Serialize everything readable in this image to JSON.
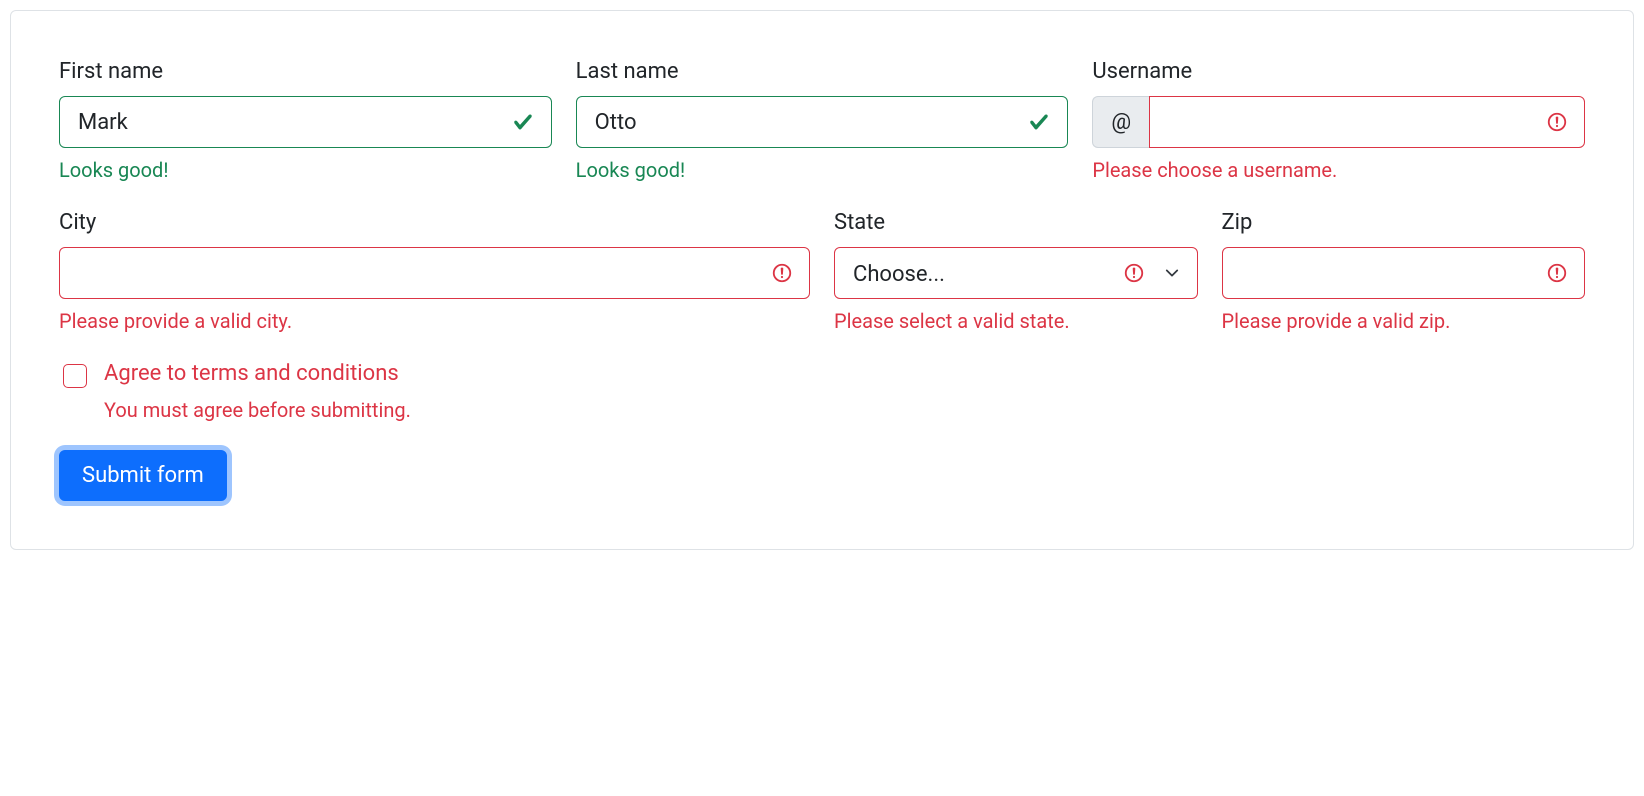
{
  "form": {
    "first_name": {
      "label": "First name",
      "value": "Mark",
      "feedback": "Looks good!"
    },
    "last_name": {
      "label": "Last name",
      "value": "Otto",
      "feedback": "Looks good!"
    },
    "username": {
      "label": "Username",
      "addon": "@",
      "value": "",
      "feedback": "Please choose a username."
    },
    "city": {
      "label": "City",
      "value": "",
      "feedback": "Please provide a valid city."
    },
    "state": {
      "label": "State",
      "selected": "Choose...",
      "feedback": "Please select a valid state."
    },
    "zip": {
      "label": "Zip",
      "value": "",
      "feedback": "Please provide a valid zip."
    },
    "terms": {
      "label": "Agree to terms and conditions",
      "feedback": "You must agree before submitting."
    },
    "submit_label": "Submit form"
  },
  "colors": {
    "valid": "#198754",
    "invalid": "#dc3545",
    "primary": "#0d6efd"
  }
}
